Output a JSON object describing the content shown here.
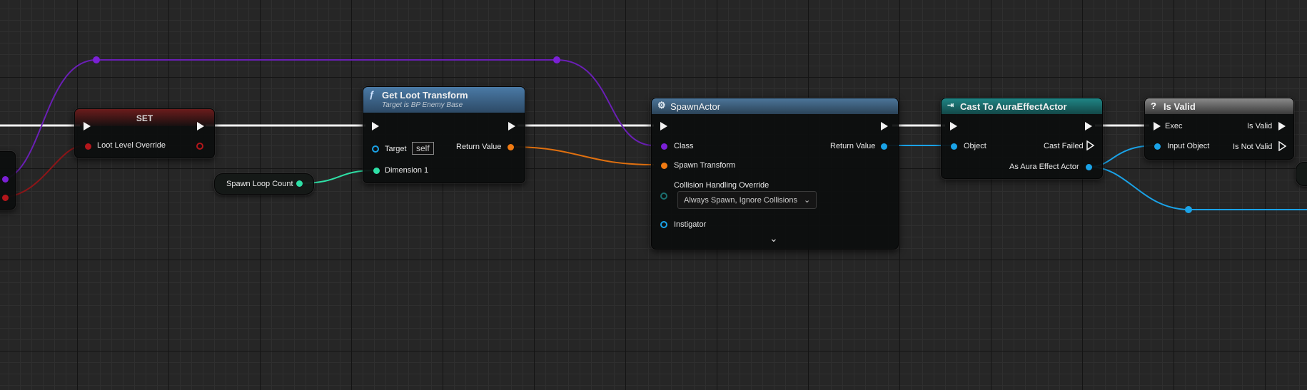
{
  "colors": {
    "exec": "#f2f2f2",
    "class_pin": "#7b20d6",
    "object_pin": "#1aa3e8",
    "struct_pin": "#f07a12",
    "int_pin": "#2ee0a6",
    "byte_pin": "#b3161b",
    "set_header": "#7a1f1f",
    "func_header": "#3f6b93",
    "cast_header": "#1b6f6f",
    "isvalid_header": "#7a7a7a"
  },
  "set_node": {
    "title": "SET",
    "var_label": "Loot Level Override"
  },
  "spawn_loop_count": {
    "label": "Spawn Loop Count"
  },
  "get_loot_transform": {
    "title": "Get Loot Transform",
    "subtitle": "Target is BP Enemy Base",
    "icon": "function-icon",
    "target_label": "Target",
    "target_value": "self",
    "dimension_label": "Dimension 1",
    "return_label": "Return Value"
  },
  "spawn_actor": {
    "title": "SpawnActor",
    "icon": "spawn-actor-icon",
    "class_label": "Class",
    "spawn_transform_label": "Spawn Transform",
    "collision_label": "Collision Handling Override",
    "collision_value": "Always Spawn, Ignore Collisions",
    "instigator_label": "Instigator",
    "return_label": "Return Value",
    "expand_icon": "chevron-down-icon"
  },
  "cast_node": {
    "title": "Cast To AuraEffectActor",
    "icon": "cast-icon",
    "object_label": "Object",
    "cast_failed_label": "Cast Failed",
    "as_label": "As Aura Effect Actor"
  },
  "is_valid": {
    "title": "Is Valid",
    "icon": "question-icon",
    "exec_label": "Exec",
    "input_label": "Input Object",
    "valid_label": "Is Valid",
    "not_valid_label": "Is Not Valid"
  }
}
